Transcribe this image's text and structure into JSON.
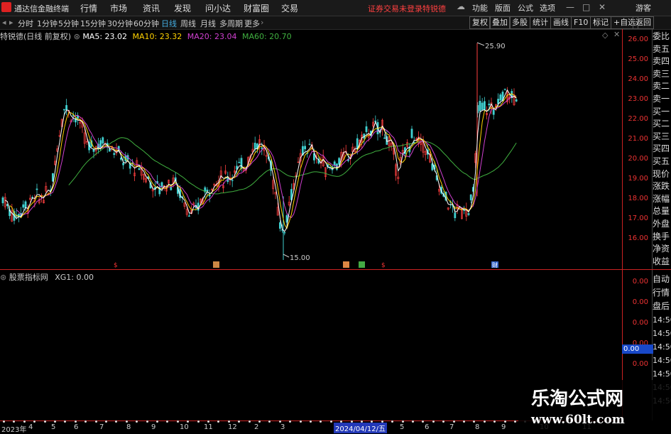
{
  "app": {
    "title": "通达信金融终端",
    "menus": [
      "行情",
      "市场",
      "资讯",
      "发现",
      "问小达",
      "财富圈",
      "交易"
    ],
    "notice": "证券交易未登录",
    "stock_tag": "特锐德",
    "right_menus": [
      "功能",
      "版面",
      "公式",
      "选项"
    ],
    "guest": "游客"
  },
  "toolbar": {
    "periods": [
      "分时",
      "1分钟",
      "5分钟",
      "15分钟",
      "30分钟",
      "60分钟",
      "日线",
      "周线",
      "月线",
      "多周期",
      "更多"
    ],
    "selected": "日线",
    "buttons": [
      "复权",
      "叠加",
      "多股",
      "统计",
      "画线",
      "F10",
      "标记",
      "+自选",
      "返回"
    ]
  },
  "legend": {
    "stock": "特锐德(日线 前复权)",
    "ma5": "MA5: 23.02",
    "ma10": "MA10: 23.32",
    "ma20": "MA20: 23.04",
    "ma60": "MA60: 20.70"
  },
  "colors": {
    "ma5": "#ffffff",
    "ma10": "#ffd200",
    "ma20": "#d040d0",
    "ma60": "#40b040",
    "up": "#ff4040",
    "down": "#40d0d0",
    "scale": "#e33"
  },
  "price_scale": [
    "26.00",
    "25.00",
    "24.00",
    "23.00",
    "22.00",
    "21.00",
    "20.00",
    "19.00",
    "18.00",
    "17.00",
    "16.00"
  ],
  "annotations": {
    "high": "25.90",
    "low": "15.00"
  },
  "markers": [
    "$",
    "◘",
    "$",
    "财"
  ],
  "indicator": {
    "name": "股票指标网",
    "value": "XG1: 0.00",
    "scale": [
      "0.00",
      "0.00",
      "0.00",
      "0.00",
      "0.00"
    ],
    "highlight": "0.00"
  },
  "order_panel": [
    "委比",
    "卖五",
    "卖四",
    "卖三",
    "卖二",
    "卖一",
    "买一",
    "买二",
    "买三",
    "买四",
    "买五",
    "现价",
    "涨跌",
    "涨幅",
    "总量",
    "外盘",
    "换手",
    "净资",
    "收益"
  ],
  "side_bottom": [
    "自动",
    "行情",
    "盘后",
    "14:50",
    "14:50",
    "14:50",
    "14:50",
    "14:50",
    "14:50",
    "14:50"
  ],
  "x_axis": [
    "2023年",
    "4",
    "5",
    "6",
    "7",
    "8",
    "9",
    "10",
    "11",
    "12",
    "2",
    "3",
    "2024/04/12/五",
    "5",
    "6",
    "7",
    "8",
    "9",
    "10",
    "11"
  ],
  "watermark": {
    "cn": "乐淘公式网",
    "url": "www.60lt.com"
  }
}
